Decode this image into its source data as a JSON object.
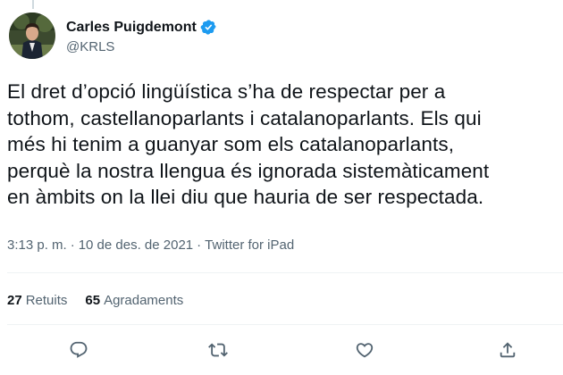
{
  "author": {
    "display_name": "Carles Puigdemont",
    "handle": "@KRLS",
    "verified": true
  },
  "tweet": {
    "text": "El dret d’opció lingüística s’ha de respectar per a\ntothom, castellanoparlants i catalanoparlants. Els qui\nmés hi tenim a guanyar som els catalanoparlants,\nperquè la nostra llengua és ignorada sistemàticament\nen àmbits on la llei diu que hauria de ser respectada."
  },
  "meta": {
    "time": "3:13 p. m.",
    "separator": "·",
    "date": "10 de des. de 2021",
    "source": "Twitter for iPad"
  },
  "stats": {
    "retweets_count": "27",
    "retweets_label": "Retuits",
    "likes_count": "65",
    "likes_label": "Agradaments"
  },
  "actions": {
    "reply_icon": "reply-icon",
    "retweet_icon": "retweet-icon",
    "like_icon": "like-icon",
    "share_icon": "share-icon"
  },
  "colors": {
    "verified": "#1d9bf0",
    "secondary_text": "#536471",
    "divider": "#eff3f4"
  }
}
